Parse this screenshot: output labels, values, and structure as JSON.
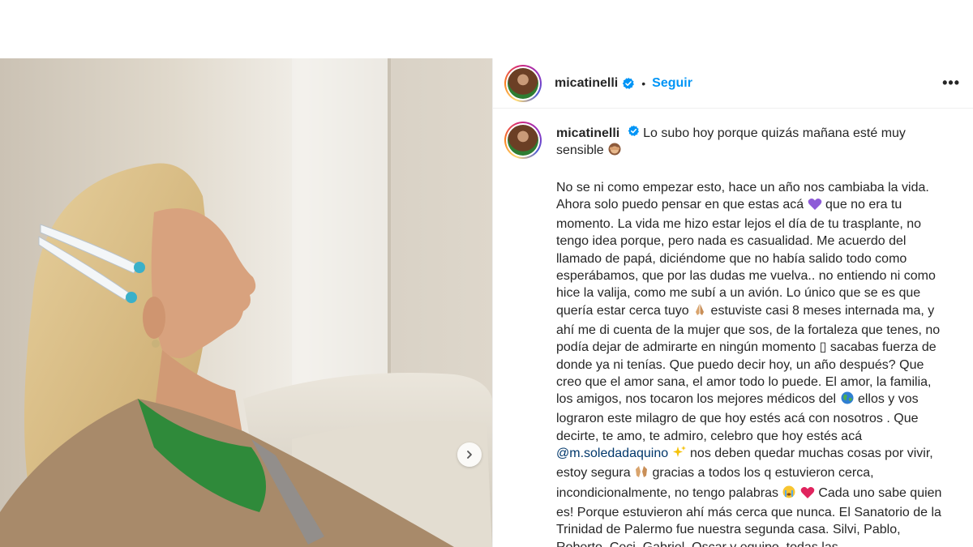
{
  "post": {
    "username": "micatinelli",
    "follow_label": "Seguir",
    "more_label": "•••",
    "separator": "•"
  },
  "caption": {
    "username": "micatinelli",
    "intro": "Lo subo hoy porque quizás mañana esté muy sensible",
    "paragraph": [
      "No se ni como empezar esto, hace un año nos cambiaba la vida. Ahora solo puedo pensar en que estas acá",
      "que no era tu momento. La vida me hizo estar lejos el día de tu trasplante, no tengo idea porque, pero nada es casualidad. Me acuerdo del llamado de papá, diciéndome que no había salido todo como esperábamos, que por las dudas me vuelva.. no entiendo ni como hice la valija, como me subí a un avión. Lo único que se es que quería estar cerca tuyo",
      "estuviste casi 8 meses internada ma, y ahí me di cuenta de la mujer que sos, de la fortaleza que tenes, no podía dejar de admirarte en ningún momento",
      "sacabas fuerza de donde ya ni tenías. Que puedo decir hoy, un año después? Que creo que el amor sana, el amor todo lo puede. El amor, la familia, los amigos, nos tocaron los mejores médicos del",
      "ellos y vos lograron este milagro de que hoy estés acá con nosotros . Que decirte, te amo, te admiro, celebro que hoy estés acá",
      "nos deben quedar muchas cosas por vivir, estoy segura",
      "gracias a todos los q estuvieron cerca, incondicionalmente, no tengo palabras",
      "Cada uno sabe quien es! Porque estuvieron ahí más cerca que nunca. El Sanatorio de la Trinidad de Palermo fue nuestra segunda casa. Silvi, Pablo, Roberto, Ceci, Gabriel, Oscar y equipo, todas las"
    ],
    "mention": "@m.soledadaquino",
    "box_glyph": "▯"
  },
  "icons": {
    "verified": "verified-badge-icon",
    "next": "chevron-right-icon",
    "emojis": [
      "see-no-evil-monkey-icon",
      "purple-heart-icon",
      "folded-hands-icon",
      "globe-icon",
      "sparkles-icon",
      "raising-hands-icon",
      "crying-face-icon",
      "red-heart-icon"
    ]
  },
  "colors": {
    "follow": "#0095f6",
    "verified": "#0095f6",
    "mention": "#00376b",
    "text": "#262626"
  }
}
